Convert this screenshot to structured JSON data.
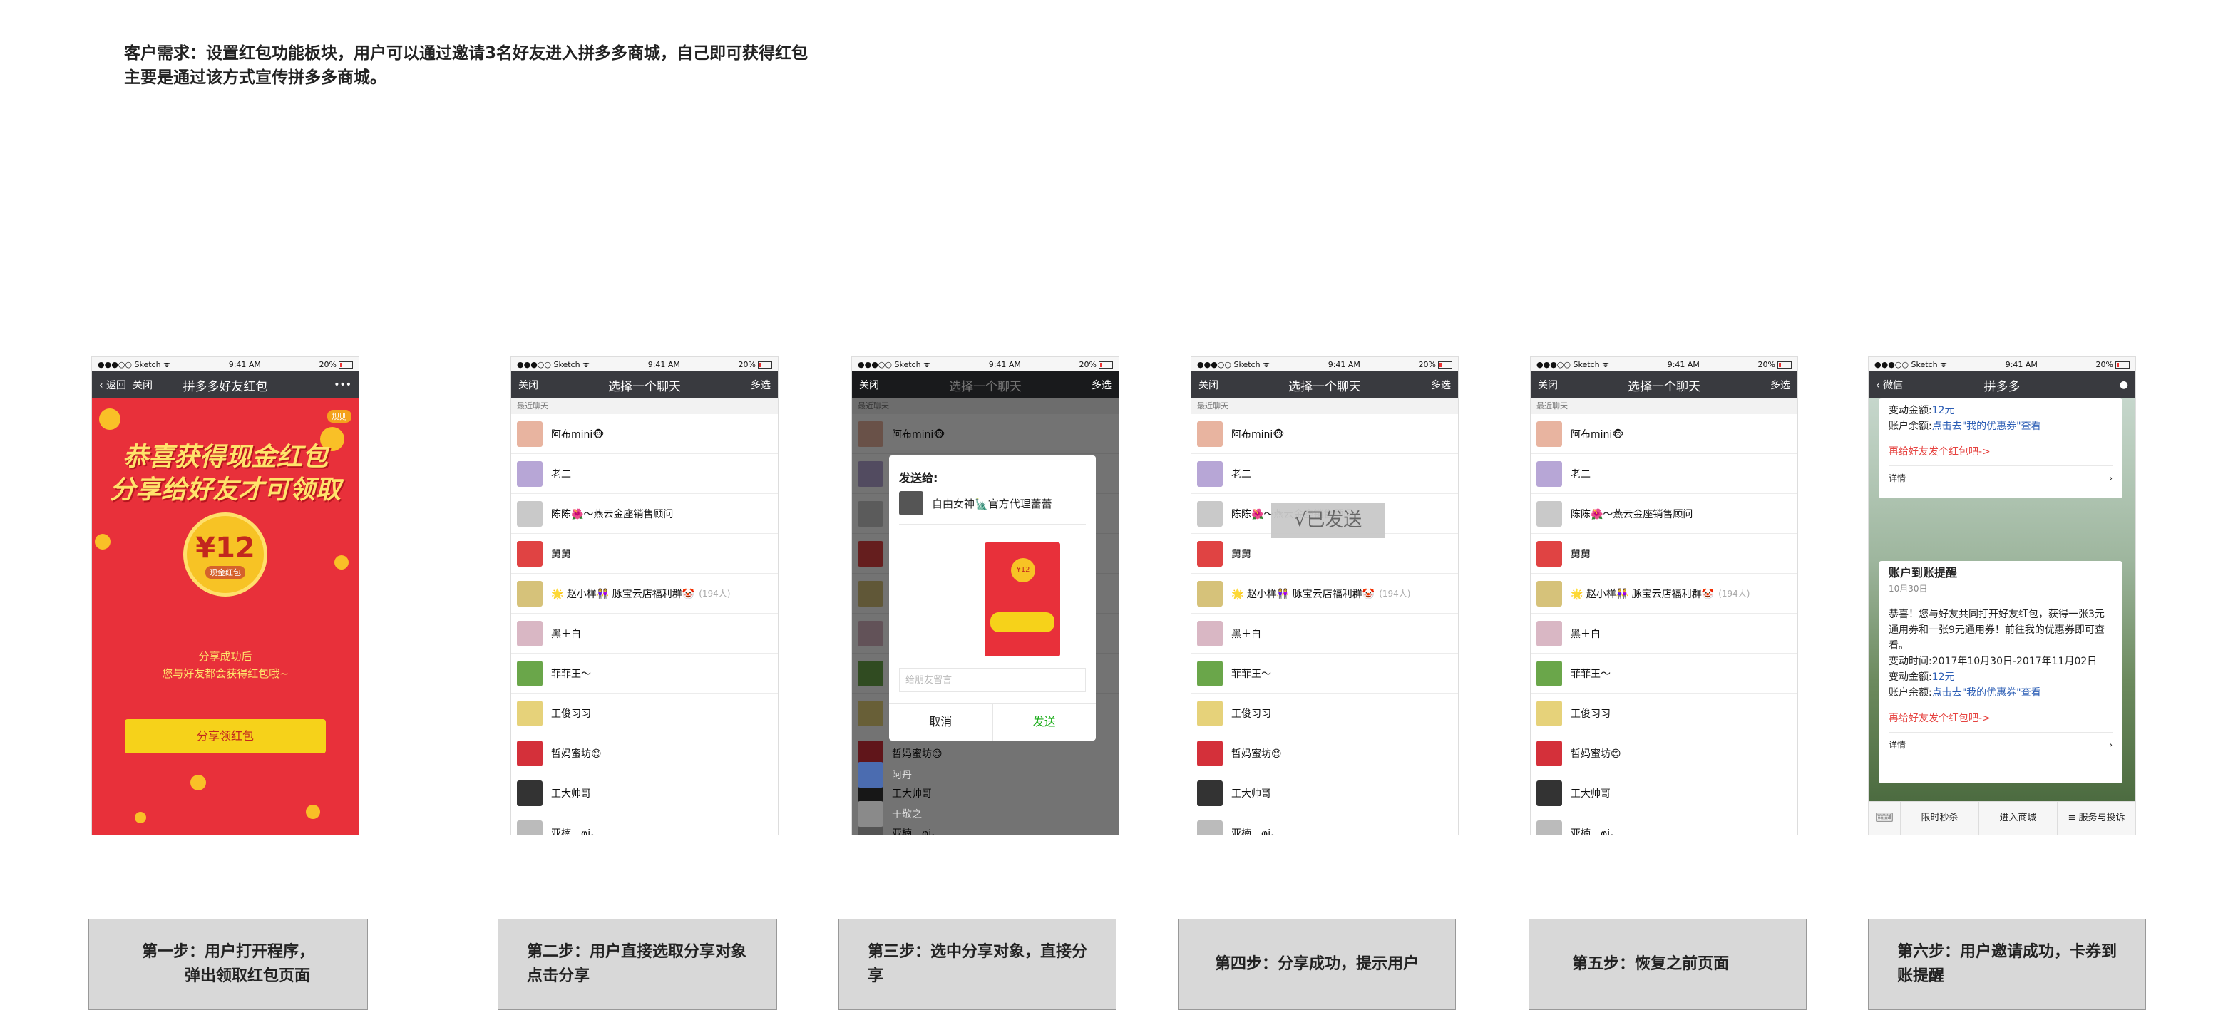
{
  "requirement": {
    "line1": "客户需求：设置红包功能板块，用户可以通过邀请3名好友进入拼多多商城，自己即可获得红包",
    "line2": "主要是通过该方式宣传拼多多商城。"
  },
  "status_bar": {
    "carrier": "●●●○○ Sketch ᯤ",
    "time": "9:41 AM",
    "battery": "20%"
  },
  "phone1": {
    "back": "返回",
    "close": "关闭",
    "title": "拼多多好友红包",
    "more": "•••",
    "rule_badge": "规则",
    "congrats_line1": "恭喜获得现金红包",
    "congrats_line2": "分享给好友才可领取",
    "amount": "¥12",
    "coin_label": "现金红包",
    "share_line1": "分享成功后",
    "share_line2": "您与好友都会获得红包哦~",
    "share_button": "分享领红包"
  },
  "chat_select": {
    "close": "关闭",
    "title": "选择一个聊天",
    "multi": "多选",
    "recent": "最近聊天",
    "chats": [
      {
        "name": "阿布mini🐵",
        "color": "#e8b4a0"
      },
      {
        "name": "老二",
        "color": "#b7a6d6"
      },
      {
        "name": "陈陈🌺～燕云金座销售顾问",
        "color": "#c9c9c9"
      },
      {
        "name": "舅舅",
        "color": "#e04343"
      },
      {
        "name": "🌟 赵小样👭 脉宝云店福利群🤡",
        "count": "(194人)",
        "color": "#d6c27a"
      },
      {
        "name": "黑＋白",
        "color": "#d9b7c4"
      },
      {
        "name": "菲菲王～",
        "color": "#6aa64a"
      },
      {
        "name": "王俊习习",
        "color": "#e6d27a"
      },
      {
        "name": "哲妈蜜坊😊",
        "color": "#d4303a"
      },
      {
        "name": "王大帅哥",
        "color": "#333333"
      },
      {
        "name": "亚楠、φi。",
        "color": "#bbbbbb"
      }
    ]
  },
  "phone3": {
    "send_to": "发送给:",
    "recipient": "自由女神🗽官方代理蕾蕾",
    "envelope_amount": "¥12",
    "message_placeholder": "给朋友留言",
    "cancel": "取消",
    "send": "发送",
    "bottom_chats": [
      "阿丹",
      "于敬之"
    ]
  },
  "phone4": {
    "toast": "√已发送"
  },
  "phone6": {
    "back": "微信",
    "title": "拼多多",
    "card1": {
      "amount_label": "变动金额:",
      "amount_value": "12元",
      "balance_label": "账户余额:",
      "balance_value": "点击去\"我的优惠券\"查看",
      "link": "再给好友发个红包吧->",
      "detail": "详情"
    },
    "card2": {
      "title": "账户到账提醒",
      "date": "10月30日",
      "body": "恭喜！您与好友共同打开好友红包，获得一张3元通用券和一张9元通用券！前往我的优惠券即可查看。",
      "time_label": "变动时间:",
      "time_value": "2017年10月30日-2017年11月02日",
      "amount_label": "变动金额:",
      "amount_value": "12元",
      "balance_label": "账户余额:",
      "balance_value": "点击去\"我的优惠券\"查看",
      "link": "再给好友发个红包吧->",
      "detail": "详情"
    },
    "tabs": [
      "限时秒杀",
      "进入商城",
      "≡ 服务与投诉"
    ]
  },
  "captions": [
    {
      "line1": "第一步：用户打开程序，",
      "line2": "弹出领取红包页面"
    },
    {
      "text": "第二步：用户直接选取分享对象点击分享"
    },
    {
      "text": "第三步：选中分享对象，直接分享"
    },
    {
      "text": "第四步：分享成功，提示用户"
    },
    {
      "text": "第五步：恢复之前页面"
    },
    {
      "text": "第六步：用户邀请成功，卡券到账提醒"
    }
  ]
}
